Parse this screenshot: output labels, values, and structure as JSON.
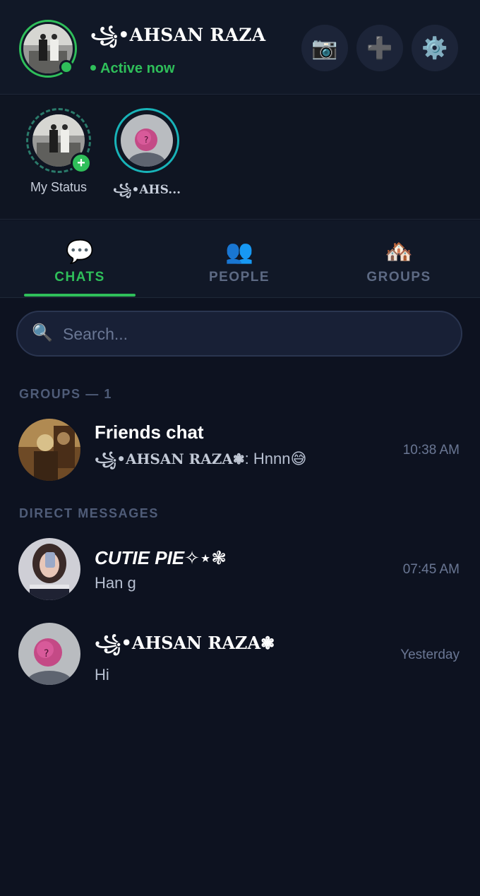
{
  "header": {
    "user_name": "꧁•AHSAN RAZA",
    "status_text": "Active now",
    "buttons": [
      {
        "name": "camera-button",
        "icon": "camera-icon",
        "glyph": "📷"
      },
      {
        "name": "add-button",
        "icon": "plus-icon",
        "glyph": "➕"
      },
      {
        "name": "settings-button",
        "icon": "gear-icon",
        "glyph": "⚙️"
      }
    ]
  },
  "statuses": [
    {
      "label": "My Status",
      "badge": "+"
    },
    {
      "label": "꧁•AHS..."
    }
  ],
  "tabs": [
    {
      "label": "CHATS",
      "glyph": "💬",
      "active": true
    },
    {
      "label": "PEOPLE",
      "glyph": "👥",
      "active": false
    },
    {
      "label": "GROUPS",
      "glyph": "🏘️",
      "active": false
    }
  ],
  "search": {
    "placeholder": "Search...",
    "glyph": "🔍"
  },
  "groups_section": {
    "title": "GROUPS — 1",
    "items": [
      {
        "title": "Friends chat",
        "sender": "꧁•AHSAN RAZA❃",
        "message": ": Hnnn😅",
        "time": "10:38 AM"
      }
    ]
  },
  "dm_section": {
    "title": "DIRECT MESSAGES",
    "items": [
      {
        "title": "CUTIE PIE✧⋆❃",
        "message": "Han g",
        "time": "07:45 AM"
      },
      {
        "title": "꧁•AHSAN RAZA❃",
        "message": "Hi",
        "time": "Yesterday"
      }
    ]
  },
  "colors": {
    "accent": "#2fbf5a",
    "background": "#0d1220",
    "muted": "#5d6a84",
    "ring": "#18b3b8"
  }
}
